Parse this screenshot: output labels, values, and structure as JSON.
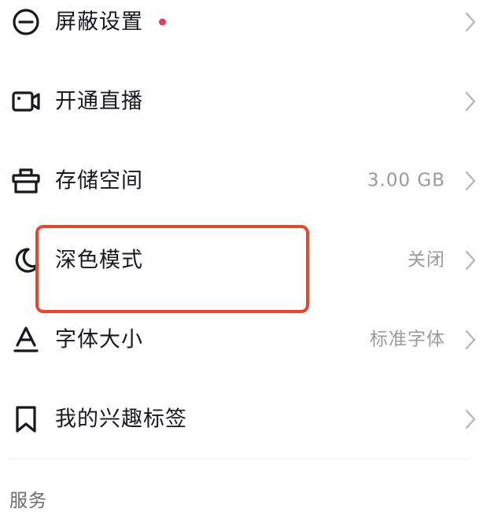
{
  "settings": {
    "items": [
      {
        "icon": "block-icon",
        "label": "屏蔽设置",
        "value": "",
        "has_dot": true,
        "dot_color": "#e0405f"
      },
      {
        "icon": "video-camera-icon",
        "label": "开通直播",
        "value": ""
      },
      {
        "icon": "storage-box-icon",
        "label": "存储空间",
        "value": "3.00 GB"
      },
      {
        "icon": "moon-icon",
        "label": "深色模式",
        "value": "关闭"
      },
      {
        "icon": "font-a-icon",
        "label": "字体大小",
        "value": "标准字体"
      },
      {
        "icon": "bookmark-icon",
        "label": "我的兴趣标签",
        "value": ""
      }
    ]
  },
  "section": {
    "title": "服务"
  },
  "colors": {
    "highlight_border": "#e8472f",
    "text_primary": "#161823",
    "text_secondary": "#9a9a9e",
    "dot": "#e0405f"
  }
}
